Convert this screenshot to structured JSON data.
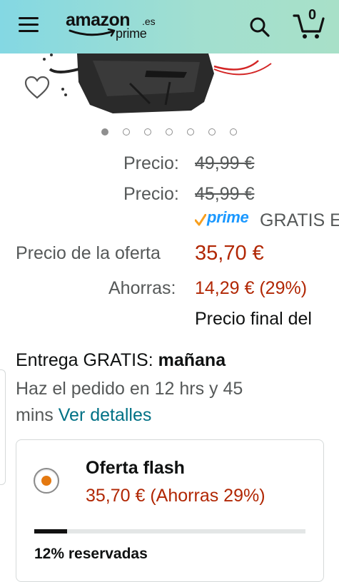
{
  "header": {
    "logo_word": "amazon",
    "logo_tld": ".es",
    "logo_sub": "prime",
    "cart_count": "0"
  },
  "carousel": {
    "count": 7,
    "active": 0
  },
  "price": {
    "list_label_1": "Precio:",
    "list_price_1": "49,99 €",
    "list_label_2": "Precio:",
    "list_price_2": "45,99 €",
    "prime_label": "prime",
    "prime_shipping": "GRATIS E",
    "deal_label": "Precio de la oferta",
    "deal_price": "35,70 €",
    "savings_label": "Ahorras:",
    "savings_value": "14,29 € (29%)",
    "final_price_text": "Precio final del"
  },
  "delivery": {
    "label": "Entrega GRATIS:",
    "date": "mañana",
    "order_within_1": "Haz el pedido en 12 hrs y 45",
    "order_within_2": "mins",
    "details_link": "Ver detalles"
  },
  "offer": {
    "title": "Oferta flash",
    "price_line": "35,70 € (Ahorras 29%)",
    "claimed_fraction": 0.12,
    "claimed_text": "12% reservadas"
  },
  "colors": {
    "header_gradient_start": "#84d8e3",
    "header_gradient_end": "#a8e0c8",
    "price_red": "#b12704",
    "link_blue": "#007185",
    "prime_blue": "#1a98ff",
    "radio_orange": "#e47911"
  },
  "icons": [
    "menu-icon",
    "search-icon",
    "cart-icon",
    "heart-icon",
    "prime-check-icon"
  ]
}
